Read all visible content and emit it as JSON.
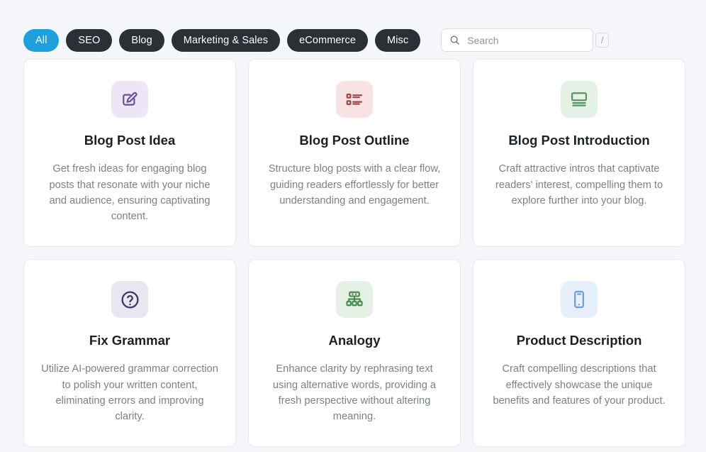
{
  "toolbar": {
    "filters": [
      {
        "label": "All",
        "active": true
      },
      {
        "label": "SEO",
        "active": false
      },
      {
        "label": "Blog",
        "active": false
      },
      {
        "label": "Marketing & Sales",
        "active": false
      },
      {
        "label": "eCommerce",
        "active": false
      },
      {
        "label": "Misc",
        "active": false
      }
    ],
    "search": {
      "placeholder": "Search",
      "value": "",
      "icon": "search-icon",
      "shortcut_badge": "/"
    },
    "active_pill_color": "#1f9fdd",
    "pill_color": "#2b3036"
  },
  "cards": [
    {
      "title": "Blog Post Idea",
      "description": "Get fresh ideas for engaging blog posts that resonate with your niche and audience, ensuring captivating content.",
      "icon": "edit-square-icon",
      "icon_color": "#6b4f9e",
      "tile_color": "#ece6f7"
    },
    {
      "title": "Blog Post Outline",
      "description": "Structure blog posts with a clear flow, guiding readers effortlessly for better understanding and engagement.",
      "icon": "list-outline-icon",
      "icon_color": "#9e4b4b",
      "tile_color": "#f9e2e4"
    },
    {
      "title": "Blog Post Introduction",
      "description": "Craft attractive intros that captivate readers' interest, compelling them to explore further into your blog.",
      "icon": "article-icon",
      "icon_color": "#5a9361",
      "tile_color": "#e6f1e6"
    },
    {
      "title": "Fix Grammar",
      "description": "Utilize AI-powered grammar correction to polish your written content, eliminating errors and improving clarity.",
      "icon": "question-circle-icon",
      "icon_color": "#3b3a5e",
      "tile_color": "#e8e6f1"
    },
    {
      "title": "Analogy",
      "description": "Enhance clarity by rephrasing text using alternative words, providing a fresh perspective without altering meaning.",
      "icon": "sitemap-icon",
      "icon_color": "#4b8a4f",
      "tile_color": "#e6f1e6"
    },
    {
      "title": "Product Description",
      "description": "Craft compelling descriptions that effectively showcase the unique benefits and features of your product.",
      "icon": "mobile-phone-icon",
      "icon_color": "#6f9bd6",
      "tile_color": "#e7effb"
    }
  ],
  "colors": {
    "page_background": "#f4f6f9",
    "card_background": "#ffffff",
    "card_border": "#e6e9ed",
    "title_text": "#1b2025",
    "body_text": "#7b8189"
  }
}
